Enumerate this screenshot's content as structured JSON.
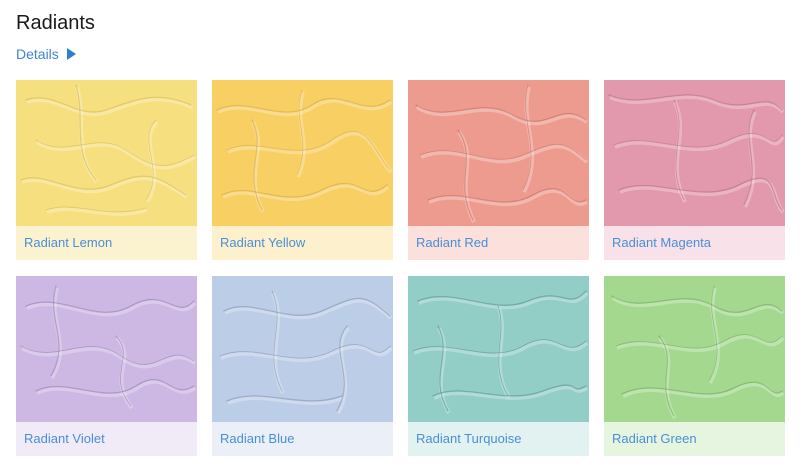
{
  "header": {
    "title": "Radiants",
    "details_label": "Details"
  },
  "swatches": [
    {
      "name": "Radiant Lemon",
      "color": "#f5df7e",
      "strip": "#fbf3cf",
      "stroke": "#c8ac3e"
    },
    {
      "name": "Radiant Yellow",
      "color": "#f8cf63",
      "strip": "#fdf0cc",
      "stroke": "#c99a2c"
    },
    {
      "name": "Radiant Red",
      "color": "#ee9b8f",
      "strip": "#fbe0dc",
      "stroke": "#b95c52"
    },
    {
      "name": "Radiant Magenta",
      "color": "#e298ad",
      "strip": "#f8e1e8",
      "stroke": "#a85c74"
    },
    {
      "name": "Radiant Violet",
      "color": "#cdb8e3",
      "strip": "#f1ebf8",
      "stroke": "#7f6a99"
    },
    {
      "name": "Radiant Blue",
      "color": "#bccde7",
      "strip": "#ebf0f8",
      "stroke": "#6c7f99"
    },
    {
      "name": "Radiant Turquoise",
      "color": "#92cdc6",
      "strip": "#e2f2f0",
      "stroke": "#3f7f78"
    },
    {
      "name": "Radiant Green",
      "color": "#a4d88f",
      "strip": "#e6f5df",
      "stroke": "#5e9648"
    }
  ]
}
